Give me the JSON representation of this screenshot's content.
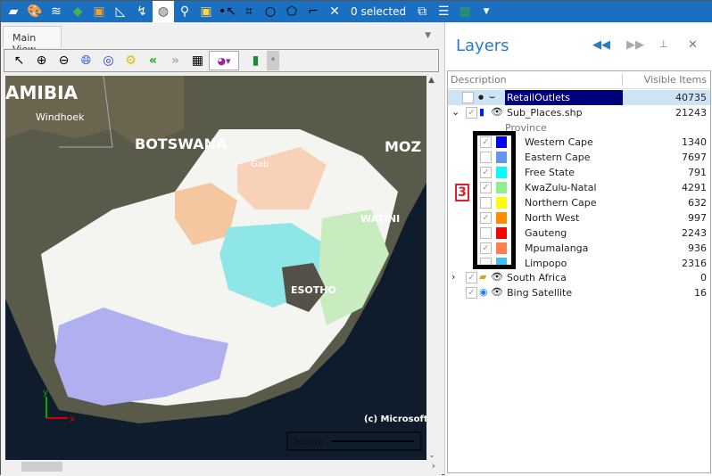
{
  "toolbar": {
    "icons": [
      "folder-icon",
      "palette-icon",
      "layers-icon",
      "google-maps-icon",
      "bing-icon",
      "measure-icon",
      "coordinate-icon",
      "globe-icon",
      "pin-icon",
      "frame-icon",
      "select-point-icon",
      "select-rect-icon",
      "select-circle-icon",
      "select-polygon-icon",
      "select-line-icon",
      "clear-selection-icon"
    ],
    "selected_text": "0 selected",
    "right_icons": [
      "zoom-to-selection-icon",
      "table-icon",
      "excel-export-icon",
      "dropdown-icon"
    ]
  },
  "main_view": {
    "tab_label": "Main View",
    "tools": [
      "pointer-icon",
      "zoom-in-icon",
      "zoom-out-icon",
      "full-extent-icon",
      "zoom-extent-icon",
      "settings-icon",
      "back-icon",
      "forward-icon",
      "grid-icon",
      "theme-icon",
      "bookmark-icon"
    ],
    "star_button": "*"
  },
  "map": {
    "labels": {
      "namibia": "AMIBIA",
      "windhoek": "Windhoek",
      "botswana": "BOTSWANA",
      "moz": "MOZ",
      "gaborone": "Gab",
      "eswatini": "WATINI",
      "lesotho": "ESOTHO"
    },
    "copyright": "(c) Microsoft",
    "scale": "300km",
    "axis_x": "x",
    "axis_y": "y"
  },
  "layers": {
    "title": "Layers",
    "columns": [
      "Description",
      "Visible Items"
    ],
    "rows": [
      {
        "name": "RetailOutlets",
        "count": "40735",
        "checked": false
      },
      {
        "name": "Sub_Places.shp",
        "count": "21243",
        "checked": true
      }
    ],
    "group_label": "Province",
    "provinces": [
      {
        "name": "Western Cape",
        "count": "1340",
        "checked": true,
        "color": "#0000ff"
      },
      {
        "name": "Eastern Cape",
        "count": "7697",
        "checked": false,
        "color": "#6495ed"
      },
      {
        "name": "Free State",
        "count": "791",
        "checked": true,
        "color": "#00ffff"
      },
      {
        "name": "KwaZulu-Natal",
        "count": "4291",
        "checked": true,
        "color": "#90ee90"
      },
      {
        "name": "Northern Cape",
        "count": "632",
        "checked": false,
        "color": "#ffff00"
      },
      {
        "name": "North West",
        "count": "997",
        "checked": true,
        "color": "#ff8c00"
      },
      {
        "name": "Gauteng",
        "count": "2243",
        "checked": false,
        "color": "#ff0000"
      },
      {
        "name": "Mpumalanga",
        "count": "936",
        "checked": true,
        "color": "#ff7f50"
      },
      {
        "name": "Limpopo",
        "count": "2316",
        "checked": false,
        "color": "#40c0ff"
      }
    ],
    "bottom_rows": [
      {
        "name": "South Africa",
        "count": "0",
        "checked": true
      },
      {
        "name": "Bing Satellite",
        "count": "16",
        "checked": true
      }
    ],
    "annotation": "3"
  }
}
